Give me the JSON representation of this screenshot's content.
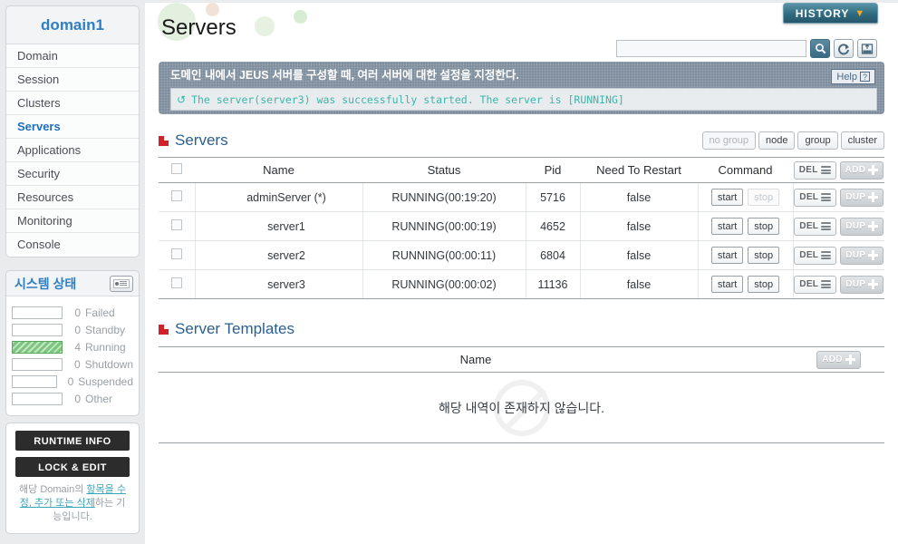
{
  "sidebar": {
    "domain_title": "domain1",
    "nav": [
      {
        "label": "Domain",
        "active": false
      },
      {
        "label": "Session",
        "active": false
      },
      {
        "label": "Clusters",
        "active": false
      },
      {
        "label": "Servers",
        "active": true
      },
      {
        "label": "Applications",
        "active": false
      },
      {
        "label": "Security",
        "active": false
      },
      {
        "label": "Resources",
        "active": false
      },
      {
        "label": "Monitoring",
        "active": false
      },
      {
        "label": "Console",
        "active": false
      }
    ],
    "system_status": {
      "title": "시스템 상태",
      "icon": "laptop-icon",
      "rows": [
        {
          "count": "0",
          "label": "Failed",
          "filled": false
        },
        {
          "count": "0",
          "label": "Standby",
          "filled": false
        },
        {
          "count": "4",
          "label": "Running",
          "filled": true
        },
        {
          "count": "0",
          "label": "Shutdown",
          "filled": false
        },
        {
          "count": "0",
          "label": "Suspended",
          "filled": false
        },
        {
          "count": "0",
          "label": "Other",
          "filled": false
        }
      ]
    },
    "runtime_info_label": "RUNTIME INFO",
    "lock_edit_label": "LOCK & EDIT",
    "description_line1_pre": "해당 Domain의 ",
    "description_link1": "항목",
    "description_link2": "을 수정, 추가 또는 삭",
    "description_link3": "제",
    "description_tail": "하는 기능입니다."
  },
  "header": {
    "page_title": "Servers",
    "history_label": "HISTORY",
    "history_chevron": "chevron-down-icon",
    "search_value": "",
    "search_placeholder": "",
    "icons": [
      {
        "name": "search-icon",
        "glyph": "⌕"
      },
      {
        "name": "refresh-icon",
        "glyph": "↺"
      },
      {
        "name": "xml-export-icon",
        "glyph": "XML"
      }
    ]
  },
  "info": {
    "description": "도메인 내에서 JEUS 서버를 구성할 때, 여러 서버에 대한 설정을 지정한다.",
    "help_label": "Help",
    "message": "The server(server3) was successfully started. The server is [RUNNING]",
    "message_icon": "refresh-spinner-icon"
  },
  "servers_section": {
    "title": "Servers",
    "filter_buttons": [
      {
        "label": "no group",
        "disabled": true
      },
      {
        "label": "node",
        "disabled": false
      },
      {
        "label": "group",
        "disabled": false
      },
      {
        "label": "cluster",
        "disabled": false
      }
    ],
    "columns": [
      "Name",
      "Status",
      "Pid",
      "Need To Restart",
      "Command"
    ],
    "header_actions": [
      {
        "label": "DEL",
        "style": "light",
        "icon": "stack-icon"
      },
      {
        "label": "ADD",
        "style": "grey",
        "icon": "plus-icon"
      }
    ],
    "rows": [
      {
        "name": "adminServer (*)",
        "status": "RUNNING(00:19:20)",
        "pid": "5716",
        "need_to_restart": "false",
        "start_label": "start",
        "stop_label": "stop",
        "start_disabled": false,
        "stop_disabled": true,
        "del_label": "DEL",
        "dup_label": "DUP"
      },
      {
        "name": "server1",
        "status": "RUNNING(00:00:19)",
        "pid": "4652",
        "need_to_restart": "false",
        "start_label": "start",
        "stop_label": "stop",
        "start_disabled": false,
        "stop_disabled": false,
        "del_label": "DEL",
        "dup_label": "DUP"
      },
      {
        "name": "server2",
        "status": "RUNNING(00:00:11)",
        "pid": "6804",
        "need_to_restart": "false",
        "start_label": "start",
        "stop_label": "stop",
        "start_disabled": false,
        "stop_disabled": false,
        "del_label": "DEL",
        "dup_label": "DUP"
      },
      {
        "name": "server3",
        "status": "RUNNING(00:00:02)",
        "pid": "11136",
        "need_to_restart": "false",
        "start_label": "start",
        "stop_label": "stop",
        "start_disabled": false,
        "stop_disabled": false,
        "del_label": "DEL",
        "dup_label": "DUP"
      }
    ]
  },
  "templates_section": {
    "title": "Server Templates",
    "column_name": "Name",
    "add_label": "ADD",
    "empty_text": "해당 내역이 존재하지 않습니다."
  },
  "colors": {
    "accent_blue": "#2f7fc4",
    "section_title": "#2a5f8f",
    "bullet_red": "#d0212a",
    "info_panel": "#7f8e9e",
    "message_teal": "#3fb5a8",
    "running_green": "#7cc57c",
    "history_teal": "#2f6b80"
  }
}
